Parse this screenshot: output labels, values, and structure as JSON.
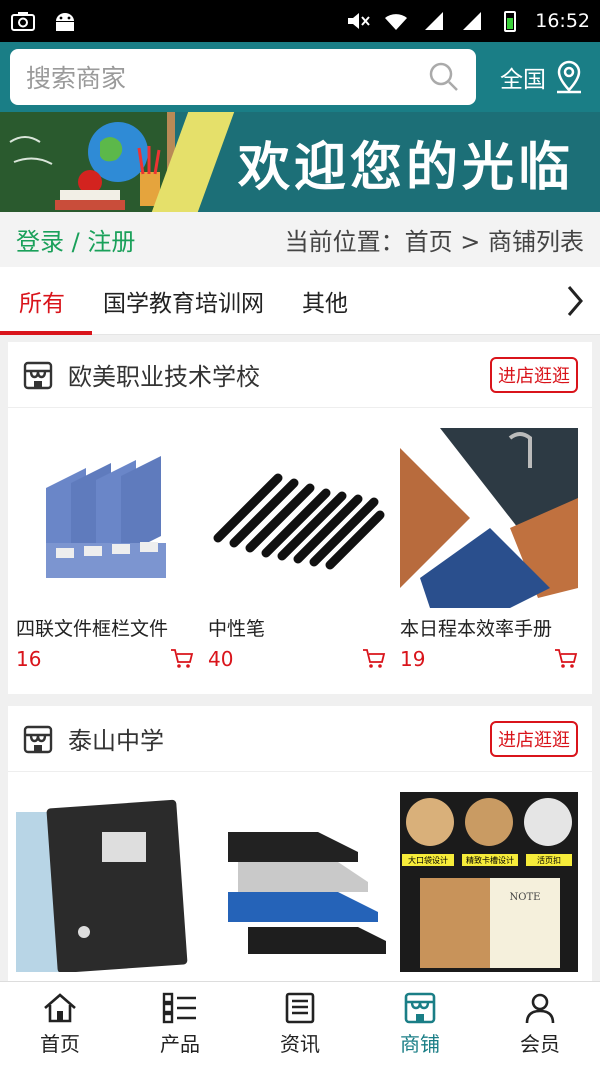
{
  "status_bar": {
    "time": "16:52"
  },
  "search": {
    "placeholder": "搜索商家"
  },
  "region": {
    "label": "全国"
  },
  "banner": {
    "title": "欢迎您的光临"
  },
  "location_row": {
    "login_label": "登录 / 注册",
    "breadcrumb": "当前位置：首页 > 商铺列表"
  },
  "tabs": [
    {
      "label": "所有",
      "active": true
    },
    {
      "label": "国学教育培训网",
      "active": false
    },
    {
      "label": "其他",
      "active": false
    }
  ],
  "shops": [
    {
      "name": "欧美职业技术学校",
      "visit_label": "进店逛逛",
      "products": [
        {
          "name": "四联文件框栏文件",
          "price": "16"
        },
        {
          "name": "中性笔",
          "price": "40"
        },
        {
          "name": "本日程本效率手册",
          "price": "19"
        }
      ]
    },
    {
      "name": "泰山中学",
      "visit_label": "进店逛逛",
      "products": [
        {
          "name": "",
          "price": ""
        },
        {
          "name": "",
          "price": ""
        },
        {
          "name": "",
          "price": ""
        }
      ]
    }
  ],
  "planner_image_text": {
    "t1": "大口袋设计",
    "t2": "精致卡槽设计",
    "t3": "活页扣",
    "note": "NOTE"
  },
  "bottom_nav": [
    {
      "label": "首页",
      "icon": "home-icon",
      "active": false
    },
    {
      "label": "产品",
      "icon": "list-icon",
      "active": false
    },
    {
      "label": "资讯",
      "icon": "news-icon",
      "active": false
    },
    {
      "label": "商铺",
      "icon": "store-icon",
      "active": true
    },
    {
      "label": "会员",
      "icon": "user-icon",
      "active": false
    }
  ],
  "colors": {
    "header": "#1a7e86",
    "accent_red": "#d9141b",
    "login_green": "#1aa05a",
    "nav_active": "#1a7e86"
  }
}
